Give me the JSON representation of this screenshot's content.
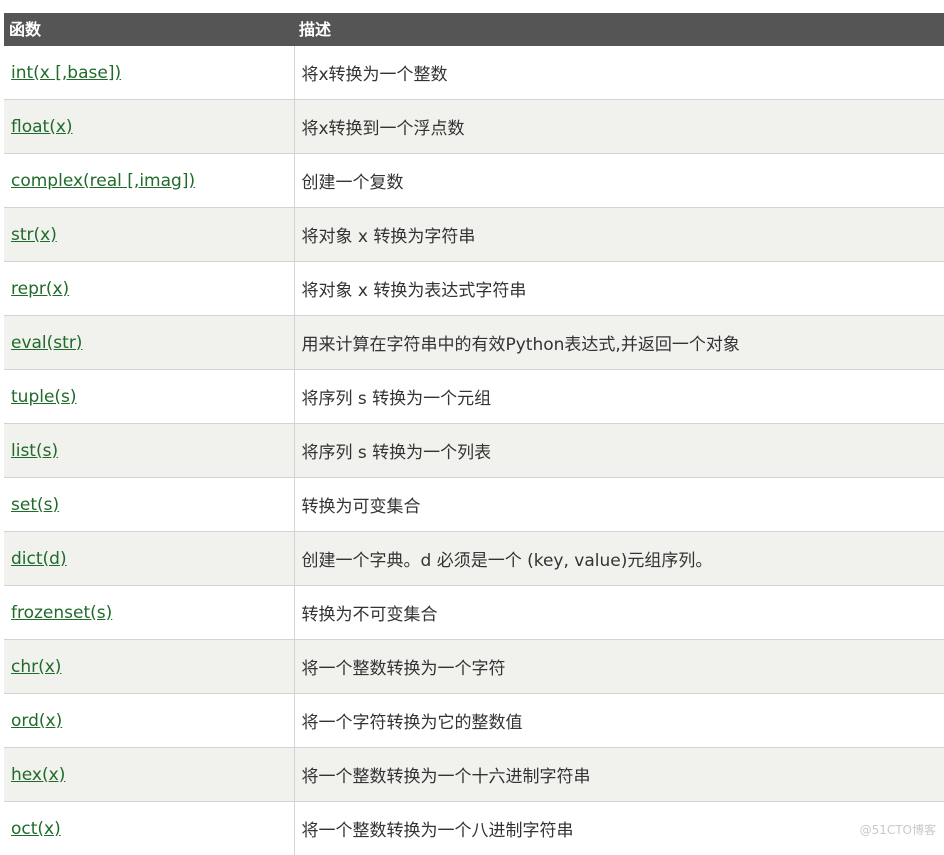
{
  "table": {
    "headers": [
      "函数",
      "描述"
    ],
    "rows": [
      {
        "fn": "int(x [,base])",
        "desc": "将x转换为一个整数"
      },
      {
        "fn": "float(x)",
        "desc": "将x转换到一个浮点数"
      },
      {
        "fn": "complex(real [,imag])",
        "desc": "创建一个复数"
      },
      {
        "fn": "str(x)",
        "desc": "将对象 x 转换为字符串"
      },
      {
        "fn": "repr(x)",
        "desc": "将对象 x 转换为表达式字符串"
      },
      {
        "fn": "eval(str)",
        "desc": "用来计算在字符串中的有效Python表达式,并返回一个对象"
      },
      {
        "fn": "tuple(s)",
        "desc": "将序列 s 转换为一个元组"
      },
      {
        "fn": "list(s)",
        "desc": "将序列 s 转换为一个列表"
      },
      {
        "fn": "set(s)",
        "desc": "转换为可变集合"
      },
      {
        "fn": "dict(d)",
        "desc": "创建一个字典。d 必须是一个 (key, value)元组序列。"
      },
      {
        "fn": "frozenset(s)",
        "desc": "转换为不可变集合"
      },
      {
        "fn": "chr(x)",
        "desc": "将一个整数转换为一个字符"
      },
      {
        "fn": "ord(x)",
        "desc": "将一个字符转换为它的整数值"
      },
      {
        "fn": "hex(x)",
        "desc": "将一个整数转换为一个十六进制字符串"
      },
      {
        "fn": "oct(x)",
        "desc": "将一个整数转换为一个八进制字符串"
      }
    ]
  },
  "watermark": "@51CTO博客",
  "colors": {
    "header_bg": "#555555",
    "link": "#1f6b2a",
    "row_alt_bg": "#f1f1ee"
  }
}
